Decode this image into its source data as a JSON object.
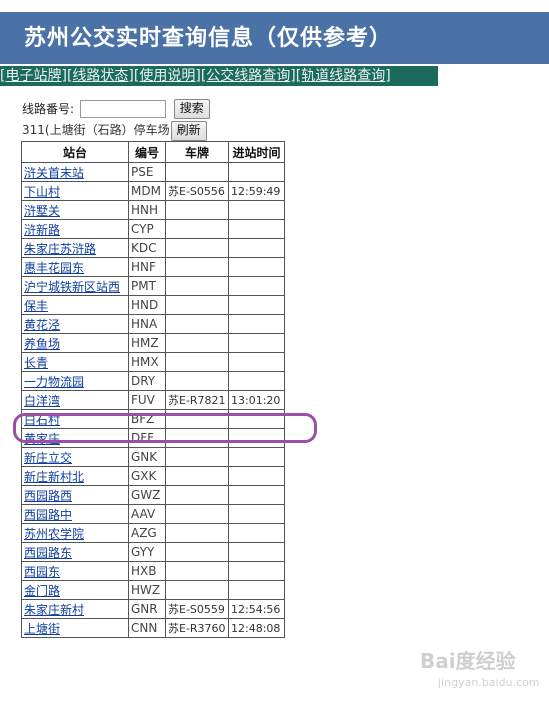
{
  "header": {
    "title": "苏州公交实时查询信息（仅供参考）"
  },
  "nav": {
    "items": [
      "[电子站牌]",
      "[线路状态]",
      "[使用说明]",
      "[公交线路查询]",
      "[轨道线路查询]"
    ]
  },
  "search": {
    "label": "线路番号:",
    "value": "",
    "button_label": "搜索"
  },
  "status": {
    "text": "311(上塘街（石路）停车场",
    "refresh_label": "刷新"
  },
  "table": {
    "headers": [
      "站台",
      "编号",
      "车牌",
      "进站时间"
    ],
    "rows": [
      {
        "name": "浒关首末站",
        "code": "PSE",
        "plate": "",
        "time": ""
      },
      {
        "name": "下山村",
        "code": "MDM",
        "plate": "苏E-S0556",
        "time": "12:59:49"
      },
      {
        "name": "浒墅关",
        "code": "HNH",
        "plate": "",
        "time": ""
      },
      {
        "name": "浒新路",
        "code": "CYP",
        "plate": "",
        "time": ""
      },
      {
        "name": "朱家庄苏浒路",
        "code": "KDC",
        "plate": "",
        "time": ""
      },
      {
        "name": "惠丰花园东",
        "code": "HNF",
        "plate": "",
        "time": ""
      },
      {
        "name": "沪宁城铁新区站西",
        "code": "PMT",
        "plate": "",
        "time": ""
      },
      {
        "name": "保丰",
        "code": "HND",
        "plate": "",
        "time": ""
      },
      {
        "name": "黄花泾",
        "code": "HNA",
        "plate": "",
        "time": ""
      },
      {
        "name": "养鱼场",
        "code": "HMZ",
        "plate": "",
        "time": ""
      },
      {
        "name": "长青",
        "code": "HMX",
        "plate": "",
        "time": ""
      },
      {
        "name": "一力物流园",
        "code": "DRY",
        "plate": "",
        "time": ""
      },
      {
        "name": "白洋湾",
        "code": "FUV",
        "plate": "苏E-R7821",
        "time": "13:01:20"
      },
      {
        "name": "白石村",
        "code": "BFZ",
        "plate": "",
        "time": ""
      },
      {
        "name": "黄家庄",
        "code": "DFF",
        "plate": "",
        "time": ""
      },
      {
        "name": "新庄立交",
        "code": "GNK",
        "plate": "",
        "time": ""
      },
      {
        "name": "新庄新村北",
        "code": "GXK",
        "plate": "",
        "time": ""
      },
      {
        "name": "西园路西",
        "code": "GWZ",
        "plate": "",
        "time": ""
      },
      {
        "name": "西园路中",
        "code": "AAV",
        "plate": "",
        "time": ""
      },
      {
        "name": "苏州农学院",
        "code": "AZG",
        "plate": "",
        "time": ""
      },
      {
        "name": "西园路东",
        "code": "GYY",
        "plate": "",
        "time": ""
      },
      {
        "name": "西园东",
        "code": "HXB",
        "plate": "",
        "time": ""
      },
      {
        "name": "金门路",
        "code": "HWZ",
        "plate": "",
        "time": ""
      },
      {
        "name": "朱家庄新村",
        "code": "GNR",
        "plate": "苏E-S0559",
        "time": "12:54:56"
      },
      {
        "name": "上塘街",
        "code": "CNN",
        "plate": "苏E-R3760",
        "time": "12:48:08"
      }
    ]
  },
  "watermark": {
    "text": "Bai度经验",
    "sub": "jingyan.baidu.com"
  },
  "colors": {
    "header_bg": "#4a72a6",
    "nav_bg": "#1c6a5c",
    "link": "#0f3e9e",
    "highlight": "#9a4ea6"
  }
}
